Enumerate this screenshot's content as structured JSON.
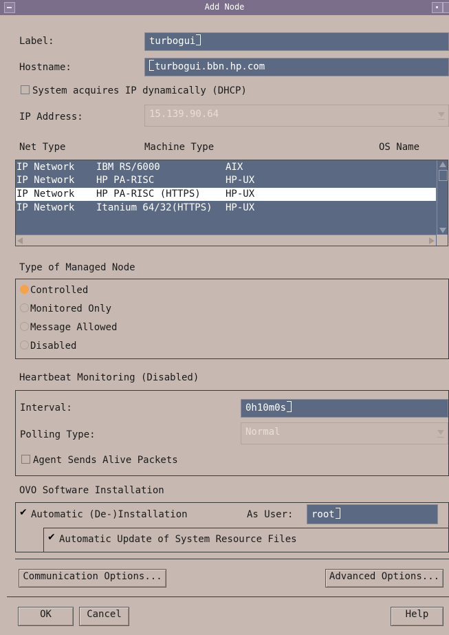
{
  "window": {
    "title": "Add Node"
  },
  "form": {
    "label_label": "Label:",
    "label_value": "turbogui",
    "hostname_label": "Hostname:",
    "hostname_value": "turbogui.bbn.hp.com",
    "dhcp_label": "System acquires IP dynamically (DHCP)",
    "ip_label": "IP Address:",
    "ip_value": "15.139.90.64"
  },
  "node_list": {
    "headers": {
      "net_type": "Net Type",
      "machine_type": "Machine Type",
      "os_name": "OS Name"
    },
    "rows": [
      {
        "net": "IP Network",
        "machine": "IBM RS/6000",
        "os": "AIX",
        "selected": false
      },
      {
        "net": "IP Network",
        "machine": "HP PA-RISC",
        "os": "HP-UX",
        "selected": false
      },
      {
        "net": "IP Network",
        "machine": "HP PA-RISC (HTTPS)",
        "os": "HP-UX",
        "selected": true
      },
      {
        "net": "IP Network",
        "machine": "Itanium 64/32(HTTPS)",
        "os": "HP-UX",
        "selected": false
      }
    ]
  },
  "managed_node": {
    "heading": "Type of Managed Node",
    "options": [
      {
        "label": "Controlled",
        "selected": true
      },
      {
        "label": "Monitored Only",
        "selected": false
      },
      {
        "label": "Message Allowed",
        "selected": false
      },
      {
        "label": "Disabled",
        "selected": false
      }
    ]
  },
  "heartbeat": {
    "heading": "Heartbeat Monitoring (Disabled)",
    "interval_label": "Interval:",
    "interval_value": "0h10m0s",
    "polling_label": "Polling Type:",
    "polling_value": "Normal",
    "alive_label": "Agent Sends Alive Packets"
  },
  "installation": {
    "heading": "OVO Software Installation",
    "auto_label": "Automatic (De-)Installation",
    "as_user_label": "As User:",
    "as_user_value": "root",
    "auto_update_label": "Automatic Update of System Resource Files"
  },
  "buttons": {
    "communication": "Communication Options...",
    "advanced": "Advanced Options...",
    "ok": "OK",
    "cancel": "Cancel",
    "help": "Help"
  },
  "colors": {
    "dialog_bg": "#c7b9b1",
    "field_bg": "#5b6a82",
    "titlebar": "#7a6e8a",
    "radio_selected": "#f5a24a"
  }
}
